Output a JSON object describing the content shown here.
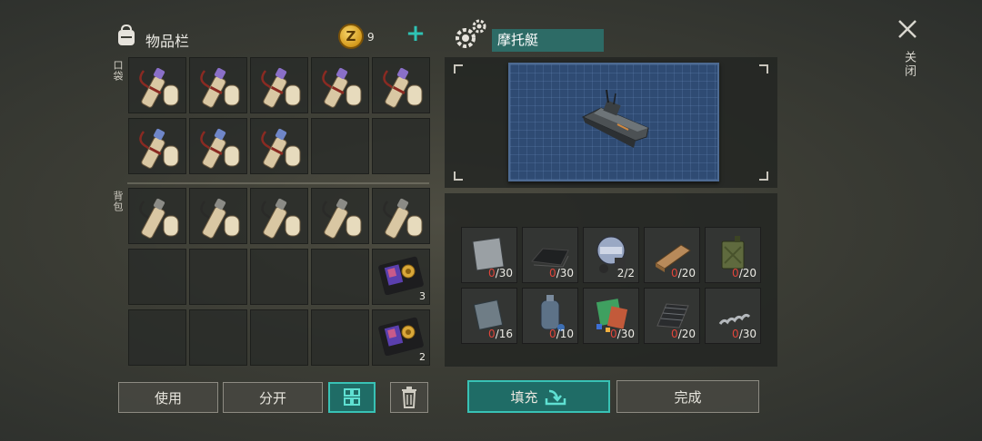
{
  "inventory": {
    "title": "物品栏",
    "coins": "9",
    "pocket_label": "口袋",
    "backpack_label": "背包",
    "pocket_slots": [
      {
        "item": "blueprint-scroll-purple",
        "count": ""
      },
      {
        "item": "blueprint-scroll-purple",
        "count": ""
      },
      {
        "item": "blueprint-scroll-purple",
        "count": ""
      },
      {
        "item": "blueprint-scroll-purple",
        "count": ""
      },
      {
        "item": "blueprint-scroll-purple",
        "count": ""
      },
      {
        "item": "blueprint-scroll-blue",
        "count": ""
      },
      {
        "item": "blueprint-scroll-blue",
        "count": ""
      },
      {
        "item": "blueprint-scroll-blue",
        "count": ""
      },
      {
        "item": "",
        "count": ""
      },
      {
        "item": "",
        "count": ""
      }
    ],
    "backpack_slots": [
      {
        "item": "blueprint-scroll-plain",
        "count": ""
      },
      {
        "item": "blueprint-scroll-plain",
        "count": ""
      },
      {
        "item": "blueprint-scroll-plain",
        "count": ""
      },
      {
        "item": "blueprint-scroll-plain",
        "count": ""
      },
      {
        "item": "blueprint-scroll-plain",
        "count": ""
      },
      {
        "item": "",
        "count": ""
      },
      {
        "item": "",
        "count": ""
      },
      {
        "item": "",
        "count": ""
      },
      {
        "item": "",
        "count": ""
      },
      {
        "item": "police-badge-wallet",
        "count": "3"
      },
      {
        "item": "",
        "count": ""
      },
      {
        "item": "",
        "count": ""
      },
      {
        "item": "",
        "count": ""
      },
      {
        "item": "",
        "count": ""
      },
      {
        "item": "police-badge-wallet",
        "count": "2"
      }
    ]
  },
  "buttons": {
    "use": "使用",
    "split": "分开",
    "fill": "填充",
    "complete": "完成"
  },
  "craft": {
    "vehicle_name": "摩托艇",
    "materials": [
      {
        "icon": "metal-sheet-icon",
        "have": "0",
        "need": "/30"
      },
      {
        "icon": "rubber-sheet-icon",
        "have": "0",
        "need": "/30"
      },
      {
        "icon": "engine-part-icon",
        "have": "2",
        "need": "2/2"
      },
      {
        "icon": "wood-plank-icon",
        "have": "0",
        "need": "/20"
      },
      {
        "icon": "fuel-can-icon",
        "have": "0",
        "need": "/20"
      },
      {
        "icon": "steel-plate-icon",
        "have": "0",
        "need": "/16"
      },
      {
        "icon": "gas-cylinder-icon",
        "have": "0",
        "need": "/10"
      },
      {
        "icon": "electronics-icon",
        "have": "0",
        "need": "/30"
      },
      {
        "icon": "corrugated-sheet-icon",
        "have": "0",
        "need": "/20"
      },
      {
        "icon": "spring-icon",
        "have": "0",
        "need": "/30"
      }
    ]
  },
  "close_label": "关闭",
  "colors": {
    "accent": "#38c2b5",
    "missing": "#e0453a"
  }
}
